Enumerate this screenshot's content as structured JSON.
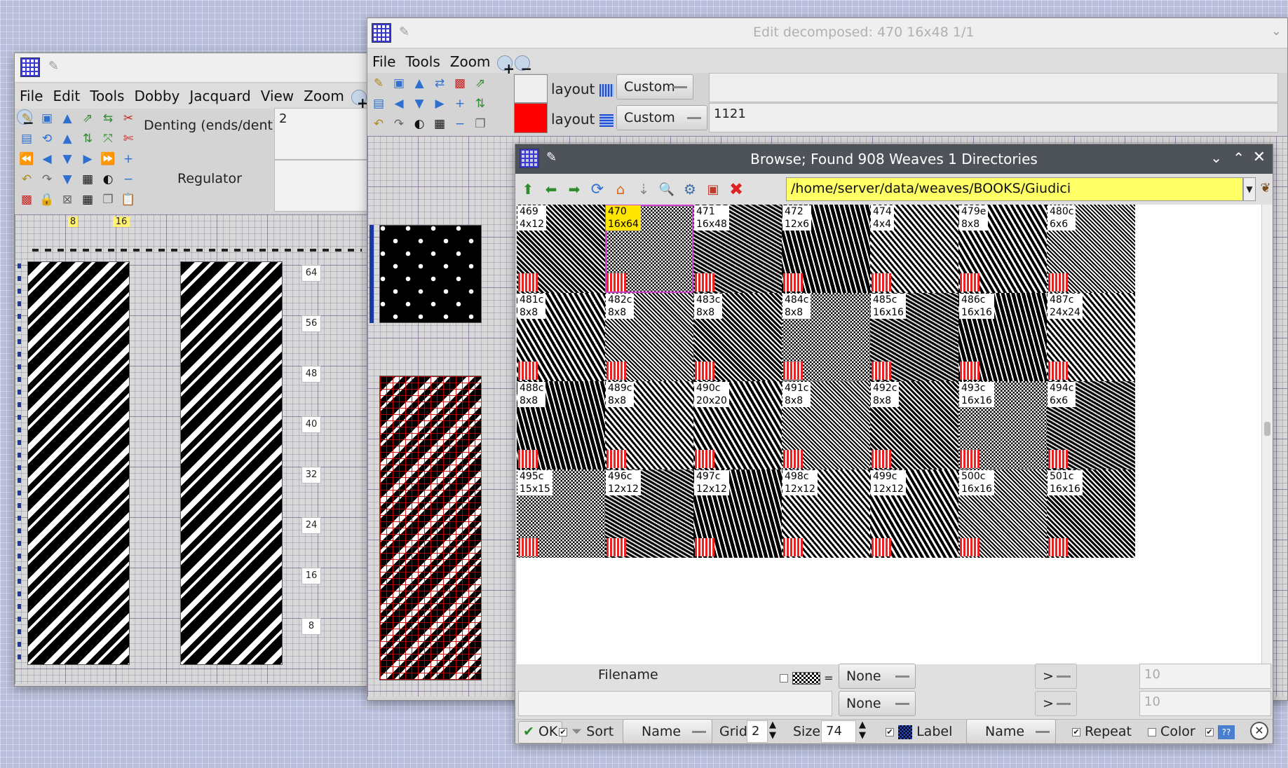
{
  "main_window": {
    "menu": [
      "File",
      "Edit",
      "Tools",
      "Dobby",
      "Jacquard",
      "View",
      "Zoom"
    ],
    "denting_label": "Denting (ends/dent)",
    "denting_value": "2",
    "regulator_label": "Regulator",
    "regulator_value": "",
    "ruler_marks": [
      "8",
      "16"
    ],
    "row_labels": [
      "64",
      "56",
      "48",
      "40",
      "32",
      "24",
      "16",
      "8"
    ]
  },
  "edit_window": {
    "title": "Edit decomposed: 470 16x48 1/1",
    "menu": [
      "File",
      "Tools",
      "Zoom"
    ],
    "layout_label_1": "layout",
    "layout_label_2": "layout",
    "combo_1": "Custom",
    "combo_2": "Custom",
    "field_1": "",
    "field_2": "1121"
  },
  "browse_window": {
    "title": "Browse; Found 908 Weaves 1 Directories",
    "path": "/home/server/data/weaves/BOOKS/Giudici",
    "tiles": [
      {
        "name": "469",
        "size": "4x12"
      },
      {
        "name": "470",
        "size": "16x64"
      },
      {
        "name": "471",
        "size": "16x48"
      },
      {
        "name": "472",
        "size": "12x6"
      },
      {
        "name": "474",
        "size": "4x4"
      },
      {
        "name": "479e",
        "size": "8x8"
      },
      {
        "name": "480c",
        "size": "6x6"
      },
      {
        "name": "481c",
        "size": "8x8"
      },
      {
        "name": "482c",
        "size": "8x8"
      },
      {
        "name": "483c",
        "size": "8x8"
      },
      {
        "name": "484c",
        "size": "8x8"
      },
      {
        "name": "485c",
        "size": "16x16"
      },
      {
        "name": "486c",
        "size": "16x16"
      },
      {
        "name": "487c",
        "size": "24x24"
      },
      {
        "name": "488c",
        "size": "8x8"
      },
      {
        "name": "489c",
        "size": "8x8"
      },
      {
        "name": "490c",
        "size": "20x20"
      },
      {
        "name": "491c",
        "size": "8x8"
      },
      {
        "name": "492c",
        "size": "8x8"
      },
      {
        "name": "493c",
        "size": "16x16"
      },
      {
        "name": "494c",
        "size": "6x6"
      },
      {
        "name": "495c",
        "size": "15x15"
      },
      {
        "name": "496c",
        "size": "12x12"
      },
      {
        "name": "497c",
        "size": "12x12"
      },
      {
        "name": "498c",
        "size": "12x12"
      },
      {
        "name": "499c",
        "size": "12x12"
      },
      {
        "name": "500c",
        "size": "16x16"
      },
      {
        "name": "501c",
        "size": "16x16"
      }
    ],
    "filename_label": "Filename",
    "filter_combo_1": "None",
    "filter_combo_2": "None",
    "compare_1": ">",
    "compare_2": ">",
    "limit_1": "10",
    "limit_2": "10",
    "ok_label": "OK",
    "sort_label": "Sort",
    "sort_combo": "Name",
    "grid_label": "Grid",
    "grid_value": "2",
    "size_label": "Size",
    "size_value": "74",
    "label_label": "Label",
    "label_combo": "Name",
    "repeat_label": "Repeat",
    "color_label": "Color"
  }
}
